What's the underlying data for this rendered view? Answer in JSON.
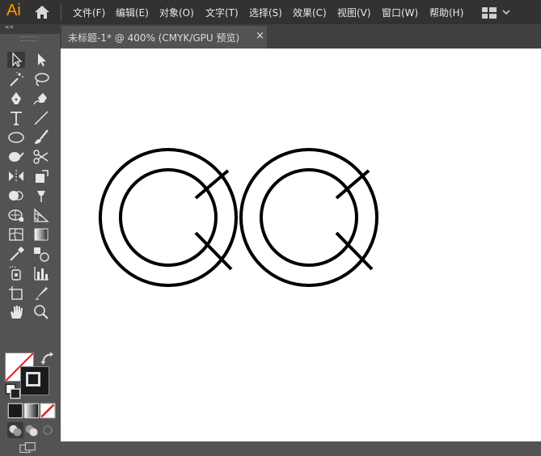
{
  "app": {
    "logo": "Ai"
  },
  "menu": [
    {
      "label": "文件(F)"
    },
    {
      "label": "编辑(E)"
    },
    {
      "label": "对象(O)"
    },
    {
      "label": "文字(T)"
    },
    {
      "label": "选择(S)"
    },
    {
      "label": "效果(C)"
    },
    {
      "label": "视图(V)"
    },
    {
      "label": "窗口(W)"
    },
    {
      "label": "帮助(H)"
    }
  ],
  "document": {
    "tab_title": "未标题-1* @ 400% (CMYK/GPU 预览)",
    "close_glyph": "×"
  },
  "toolpanel": {
    "collapse_glyph": "««"
  },
  "tools": [
    "selection-tool",
    "direct-selection-tool",
    "magic-wand-tool",
    "lasso-tool",
    "pen-tool",
    "curvature-tool",
    "type-tool",
    "line-segment-tool",
    "ellipse-tool",
    "paintbrush-tool",
    "shaper-tool",
    "scissors-tool",
    "width-tool",
    "free-transform-tool",
    "shape-builder-tool",
    "puppet-warp-tool",
    "perspective-grid-tool",
    "mesh-tool",
    "mesh-tool-2",
    "gradient-tool",
    "eyedropper-tool",
    "blend-tool",
    "symbol-sprayer-tool",
    "column-graph-tool",
    "artboard-tool",
    "slice-tool",
    "hand-tool",
    "zoom-tool"
  ],
  "colors": {
    "accent": "#ff9a00",
    "menubar": "#323232",
    "panel": "#535353",
    "canvas": "#ffffff",
    "stroke": "#000000"
  },
  "artwork": {
    "description_items": [
      "Q",
      "Q"
    ]
  }
}
